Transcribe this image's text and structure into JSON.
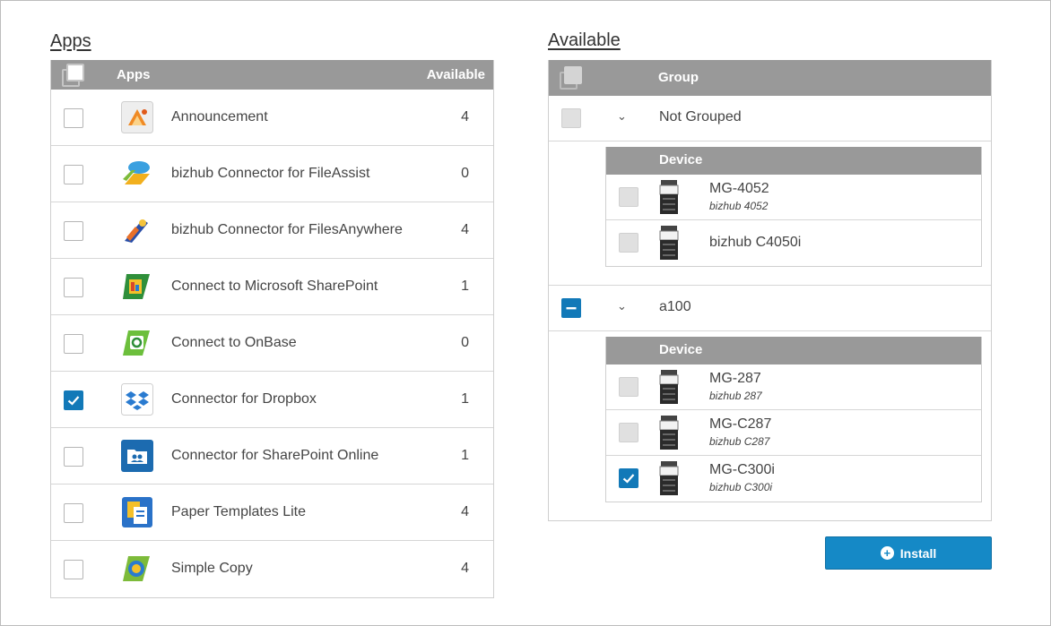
{
  "apps_title": "Apps",
  "available_title": "Available",
  "apps_table": {
    "header_apps": "Apps",
    "header_available": "Available",
    "rows": [
      {
        "name": "Announcement",
        "available": "4",
        "checked": false,
        "icon": "announcement-icon"
      },
      {
        "name": "bizhub Connector for FileAssist",
        "available": "0",
        "checked": false,
        "icon": "fileassist-icon"
      },
      {
        "name": "bizhub Connector for FilesAnywhere",
        "available": "4",
        "checked": false,
        "icon": "filesanywhere-icon"
      },
      {
        "name": "Connect to Microsoft SharePoint",
        "available": "1",
        "checked": false,
        "icon": "sharepoint-icon"
      },
      {
        "name": "Connect to OnBase",
        "available": "0",
        "checked": false,
        "icon": "onbase-icon"
      },
      {
        "name": "Connector for Dropbox",
        "available": "1",
        "checked": true,
        "icon": "dropbox-icon"
      },
      {
        "name": "Connector for SharePoint Online",
        "available": "1",
        "checked": false,
        "icon": "sharepoint-online-icon"
      },
      {
        "name": "Paper Templates Lite",
        "available": "4",
        "checked": false,
        "icon": "paper-templates-icon"
      },
      {
        "name": "Simple Copy",
        "available": "4",
        "checked": false,
        "icon": "simple-copy-icon"
      }
    ]
  },
  "available_panel": {
    "header_group": "Group",
    "device_header": "Device",
    "groups": [
      {
        "name": "Not Grouped",
        "devices": [
          {
            "name": "MG-4052",
            "model": "bizhub 4052",
            "checked": false
          },
          {
            "name": "bizhub C4050i",
            "model": "",
            "checked": false
          }
        ]
      },
      {
        "name": "a100",
        "devices": [
          {
            "name": "MG-287",
            "model": "bizhub 287",
            "checked": false
          },
          {
            "name": "MG-C287",
            "model": "bizhub C287",
            "checked": false
          },
          {
            "name": "MG-C300i",
            "model": "bizhub C300i",
            "checked": true
          }
        ]
      }
    ]
  },
  "install_button": {
    "label": "Install",
    "icon": "plus-circle-icon"
  },
  "colors": {
    "accent": "#1589c6",
    "header_bg": "#999999",
    "checkbox_checked": "#1279b8"
  }
}
